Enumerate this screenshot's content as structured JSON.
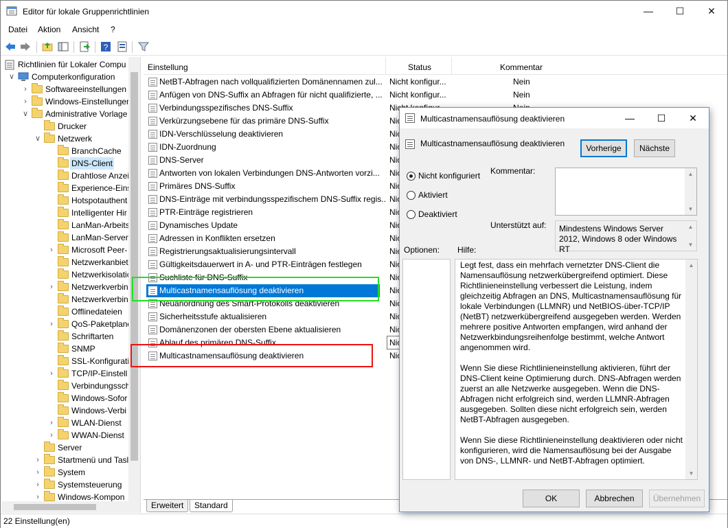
{
  "window": {
    "title": "Editor für lokale Gruppenrichtlinien"
  },
  "menu": [
    "Datei",
    "Aktion",
    "Ansicht",
    "?"
  ],
  "tree": [
    {
      "label": "Richtlinien für Lokaler Compu",
      "depth": 0,
      "chev": "",
      "icon": "policy"
    },
    {
      "label": "Computerkonfiguration",
      "depth": 1,
      "chev": "down",
      "icon": "computer"
    },
    {
      "label": "Softwareeinstellungen",
      "depth": 2,
      "chev": "right",
      "icon": "folder"
    },
    {
      "label": "Windows-Einstellungen",
      "depth": 2,
      "chev": "right",
      "icon": "folder"
    },
    {
      "label": "Administrative Vorlage",
      "depth": 2,
      "chev": "down",
      "icon": "folder"
    },
    {
      "label": "Drucker",
      "depth": 3,
      "chev": "",
      "icon": "folder"
    },
    {
      "label": "Netzwerk",
      "depth": 3,
      "chev": "down",
      "icon": "folder"
    },
    {
      "label": "BranchCache",
      "depth": 4,
      "chev": "",
      "icon": "folder"
    },
    {
      "label": "DNS-Client",
      "depth": 4,
      "chev": "",
      "icon": "folder",
      "selected": true
    },
    {
      "label": "Drahtlose Anzei",
      "depth": 4,
      "chev": "",
      "icon": "folder"
    },
    {
      "label": "Experience-Eins",
      "depth": 4,
      "chev": "",
      "icon": "folder"
    },
    {
      "label": "Hotspotauthent",
      "depth": 4,
      "chev": "",
      "icon": "folder"
    },
    {
      "label": "Intelligenter Hir",
      "depth": 4,
      "chev": "",
      "icon": "folder"
    },
    {
      "label": "LanMan-Arbeits",
      "depth": 4,
      "chev": "",
      "icon": "folder"
    },
    {
      "label": "LanMan-Server",
      "depth": 4,
      "chev": "",
      "icon": "folder"
    },
    {
      "label": "Microsoft Peer-",
      "depth": 4,
      "chev": "right",
      "icon": "folder"
    },
    {
      "label": "Netzwerkanbiet",
      "depth": 4,
      "chev": "",
      "icon": "folder"
    },
    {
      "label": "Netzwerkisolatic",
      "depth": 4,
      "chev": "",
      "icon": "folder"
    },
    {
      "label": "Netzwerkverbin",
      "depth": 4,
      "chev": "right",
      "icon": "folder"
    },
    {
      "label": "Netzwerkverbin",
      "depth": 4,
      "chev": "",
      "icon": "folder"
    },
    {
      "label": "Offlinedateien",
      "depth": 4,
      "chev": "",
      "icon": "folder"
    },
    {
      "label": "QoS-Paketplane",
      "depth": 4,
      "chev": "right",
      "icon": "folder"
    },
    {
      "label": "Schriftarten",
      "depth": 4,
      "chev": "",
      "icon": "folder"
    },
    {
      "label": "SNMP",
      "depth": 4,
      "chev": "",
      "icon": "folder"
    },
    {
      "label": "SSL-Konfigurati",
      "depth": 4,
      "chev": "",
      "icon": "folder"
    },
    {
      "label": "TCP/IP-Einstell",
      "depth": 4,
      "chev": "right",
      "icon": "folder"
    },
    {
      "label": "Verbindungssch",
      "depth": 4,
      "chev": "",
      "icon": "folder"
    },
    {
      "label": "Windows-Sofor",
      "depth": 4,
      "chev": "",
      "icon": "folder"
    },
    {
      "label": "Windows-Verbi",
      "depth": 4,
      "chev": "",
      "icon": "folder"
    },
    {
      "label": "WLAN-Dienst",
      "depth": 4,
      "chev": "right",
      "icon": "folder"
    },
    {
      "label": "WWAN-Dienst",
      "depth": 4,
      "chev": "right",
      "icon": "folder"
    },
    {
      "label": "Server",
      "depth": 3,
      "chev": "",
      "icon": "folder"
    },
    {
      "label": "Startmenü und Tasl",
      "depth": 3,
      "chev": "right",
      "icon": "folder"
    },
    {
      "label": "System",
      "depth": 3,
      "chev": "right",
      "icon": "folder"
    },
    {
      "label": "Systemsteuerung",
      "depth": 3,
      "chev": "right",
      "icon": "folder"
    },
    {
      "label": "Windows-Kompon",
      "depth": 3,
      "chev": "right",
      "icon": "folder"
    }
  ],
  "list": {
    "headers": {
      "name": "Einstellung",
      "status": "Status",
      "comment": "Kommentar"
    },
    "rows": [
      {
        "name": "NetBT-Abfragen nach vollqualifizierten Domänennamen zul...",
        "status": "Nicht konfigur...",
        "comment": "Nein"
      },
      {
        "name": "Anfügen von DNS-Suffix an Abfragen für nicht qualifizierte, ...",
        "status": "Nicht konfigur...",
        "comment": "Nein"
      },
      {
        "name": "Verbindungsspezifisches DNS-Suffix",
        "status": "Nicht konfigur...",
        "comment": "Nein"
      },
      {
        "name": "Verkürzungsebene für das primäre DNS-Suffix",
        "status": "Nicht konfigur...",
        "comment": "Nein"
      },
      {
        "name": "IDN-Verschlüsselung deaktivieren",
        "status": "Nic",
        "comment": ""
      },
      {
        "name": "IDN-Zuordnung",
        "status": "Nic",
        "comment": ""
      },
      {
        "name": "DNS-Server",
        "status": "Nic",
        "comment": ""
      },
      {
        "name": "Antworten von lokalen Verbindungen DNS-Antworten vorzi...",
        "status": "Nic",
        "comment": ""
      },
      {
        "name": "Primäres DNS-Suffix",
        "status": "Nic",
        "comment": ""
      },
      {
        "name": "DNS-Einträge mit verbindungsspezifischem DNS-Suffix regis...",
        "status": "Nic",
        "comment": ""
      },
      {
        "name": "PTR-Einträge registrieren",
        "status": "Nic",
        "comment": ""
      },
      {
        "name": "Dynamisches Update",
        "status": "Nic",
        "comment": ""
      },
      {
        "name": "Adressen in Konflikten ersetzen",
        "status": "Nic",
        "comment": ""
      },
      {
        "name": "Registrierungsaktualisierungsintervall",
        "status": "Nic",
        "comment": ""
      },
      {
        "name": "Gültigkeitsdauerwert in A- und PTR-Einträgen festlegen",
        "status": "Nic",
        "comment": ""
      },
      {
        "name": "Suchliste für DNS-Suffix",
        "status": "Nic",
        "comment": ""
      },
      {
        "name": "Multicastnamensauflösung deaktivieren",
        "status": "Nic",
        "comment": "",
        "selected": true
      },
      {
        "name": "Neuanordnung des Smart-Protokolls deaktivieren",
        "status": "Nic",
        "comment": ""
      },
      {
        "name": "Sicherheitsstufe aktualisieren",
        "status": "Nic",
        "comment": ""
      },
      {
        "name": "Domänenzonen der obersten Ebene aktualisieren",
        "status": "Nic",
        "comment": ""
      },
      {
        "name": "Ablauf des primären DNS-Suffix",
        "status": "",
        "comment": ""
      },
      {
        "name": "Multicastnamensauflösung deaktivieren",
        "status": "Nic",
        "comment": ""
      }
    ]
  },
  "tooltip": "Nic",
  "tabs": [
    "Erweitert",
    "Standard"
  ],
  "status_bar": "22 Einstellung(en)",
  "dialog": {
    "title": "Multicastnamensauflösung deaktivieren",
    "heading": "Multicastnamensauflösung deaktivieren",
    "prev_label": "Vorherige",
    "next_label": "Nächste",
    "options": {
      "not_configured": "Nicht konfiguriert",
      "enabled": "Aktiviert",
      "disabled": "Deaktiviert",
      "selected": "not_configured"
    },
    "comment_label": "Kommentar:",
    "supported_label": "Unterstützt auf:",
    "supported_value": "Mindestens Windows Server 2012, Windows 8 oder Windows RT",
    "options_label": "Optionen:",
    "help_label": "Hilfe:",
    "help_paragraphs": [
      "Legt fest, dass ein mehrfach vernetzter DNS-Client die Namensauflösung netzwerkübergreifend optimiert.  Diese Richtlinieneinstellung verbessert die Leistung, indem gleichzeitig Abfragen an DNS, Multicastnamensauflösung für lokale Verbindungen (LLMNR) und NetBIOS-über-TCP/IP (NetBT) netzwerkübergreifend ausgegeben werden. Werden mehrere positive Antworten empfangen, wird anhand der Netzwerkbindungsreihenfolge bestimmt, welche Antwort angenommen wird.",
      "Wenn Sie diese Richtlinieneinstellung aktivieren, führt der DNS-Client keine Optimierung durch.  DNS-Abfragen werden zuerst an alle Netzwerke ausgegeben. Wenn die DNS-Abfragen nicht erfolgreich sind, werden LLMNR-Abfragen ausgegeben. Sollten diese nicht erfolgreich sein, werden NetBT-Abfragen ausgegeben.",
      "Wenn Sie diese Richtlinieneinstellung deaktivieren oder nicht konfigurieren, wird die Namensauflösung bei der Ausgabe von DNS-, LLMNR- und NetBT-Abfragen optimiert."
    ],
    "ok_label": "OK",
    "cancel_label": "Abbrechen",
    "apply_label": "Übernehmen"
  },
  "colors": {
    "selection": "#0078d7",
    "tree_selection": "#cce8ff",
    "highlight_green": "#22e022",
    "highlight_red": "#ee1111"
  }
}
